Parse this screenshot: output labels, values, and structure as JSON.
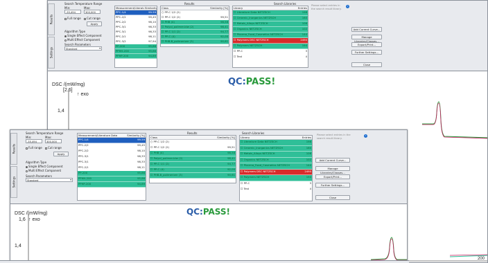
{
  "top_window": {
    "search_range_title": "Search Temperature Range",
    "min_label": "Min:",
    "max_label": "Max:",
    "min_value": "-35,494",
    "max_value": "300,000",
    "full_range": "Full range",
    "cut_range": "Cut range",
    "apply": "Apply",
    "algorithm_type": "Algorithm Type",
    "single_effect": "Single Effect Component",
    "multi_effect": "Multi Effect Component",
    "search_parameters": "Search Parameters",
    "standard": "Standard",
    "measurements_header": [
      "Measurement/Literature Data",
      "Similarity [%]"
    ],
    "measurements": [
      [
        "PPC-1/4",
        "99.59",
        "sel"
      ],
      [
        "PPC-2/2",
        "99,45",
        ""
      ],
      [
        "PPC-2/2",
        "98,10",
        ""
      ],
      [
        "PPC-3/1",
        "98,33",
        ""
      ],
      [
        "PPC-3/1",
        "98,33",
        ""
      ],
      [
        "PPC-2/1",
        "98,11",
        ""
      ],
      [
        "PPC-3/2",
        "97,94",
        ""
      ],
      [
        "PP-200",
        "95,86",
        "hit"
      ],
      [
        "PPHH-200",
        "95,86",
        "hit"
      ],
      [
        "PPHP-200",
        "94,89",
        "hit"
      ]
    ],
    "results_title": "Results",
    "results_header": [
      "Class",
      "Similarity [%]"
    ],
    "results_query": "PP-C 1/2 (2)",
    "results": [
      [
        "PP-C 1/2 (2)",
        "99,51",
        ""
      ],
      [
        "PHB (4)",
        "98,58",
        "hit"
      ],
      [
        "Polyol_polimer-blw (2)",
        "98,41",
        "hit"
      ],
      [
        "PP-C 1/1 (2)",
        "94,77",
        "hit"
      ],
      [
        "PP-C (4)",
        "92,00",
        "hit"
      ],
      [
        "PHB-B_polimerizer (3)",
        "90,61",
        "hit"
      ]
    ],
    "libraries_title": "Search Libraries",
    "libraries_header": [
      "Library",
      "Entries"
    ],
    "libraries": [
      [
        "Literature Data NETZSCH",
        "198",
        "hit"
      ],
      [
        "Ceramic_Inorganics NETZSCH",
        "160",
        "hit"
      ],
      [
        "Metals_Alloys NETZSCH",
        "106",
        "hit"
      ],
      [
        "Organics NETZSCH",
        "102",
        "hit"
      ],
      [
        "Pharma_Food_Cosmetics NETZSCH",
        "144",
        "hit"
      ],
      [
        "Polymers DSC NETZSCH",
        "2490",
        "red"
      ],
      [
        "Polymers NETZSCH",
        "194",
        "hit"
      ],
      [
        "PP-C",
        "3",
        ""
      ],
      [
        "Test",
        "4",
        ""
      ]
    ],
    "hint_text": "Please select entries in the search result library.",
    "add_current_curve": "Add Current Curve...",
    "manage_libraries": "Manage Libraries/Classes...",
    "export_print": "Export/Print...",
    "further_settings": "Further Settings...",
    "close": "Close",
    "tab_results": "Results",
    "tab_settings": "Settings",
    "qc_label": "QC:",
    "qc_status": "PASS!",
    "y_axis_label": "DSC /(mW/mg)",
    "exo_label": "↑ exo",
    "tick_a": "[2.6]",
    "tick_b": "1,4",
    "x_tick_end": "200"
  },
  "front_window": {
    "search_range_title": "Search Temperature Range",
    "min_label": "Min:",
    "max_label": "Max:",
    "min_value": "-35,494",
    "max_value": "300,000",
    "full_range": "Full range",
    "cut_range": "Cut range",
    "apply": "Apply",
    "algorithm_type": "Algorithm Type",
    "single_effect": "Single Effect Component",
    "multi_effect": "Multi Effect Component",
    "search_parameters": "Search Parameters",
    "standard": "Standard",
    "measurements_header": [
      "Measurement/Literature Data",
      "Similarity [%]"
    ],
    "measurements": [
      [
        "PPC-1/4",
        "99.59",
        "sel"
      ],
      [
        "PPC-2/2",
        "99,45",
        ""
      ],
      [
        "PPC-2/2",
        "98,10",
        ""
      ],
      [
        "PPC-3/1",
        "98,33",
        ""
      ],
      [
        "PPC-3/1",
        "98,33",
        ""
      ],
      [
        "PPC-2/1",
        "98,11",
        ""
      ],
      [
        "PP-200",
        "95,86",
        "hit"
      ],
      [
        "PPHH-200",
        "95,86",
        "hit"
      ],
      [
        "PPHP-200",
        "94,89",
        "hit"
      ]
    ],
    "results_title": "Results",
    "results_header": [
      "Class",
      "Similarity [%]"
    ],
    "results_query": "PP-C 1/2 (2)",
    "results": [
      [
        "PP-C 1/2 (2)",
        "99,51",
        ""
      ],
      [
        "PHB (4)",
        "98,58",
        "hit"
      ],
      [
        "Polyol_polimer-blw (2)",
        "98,41",
        "hit"
      ],
      [
        "PP-C 1/1 (2)",
        "94,77",
        "hit"
      ],
      [
        "PP-C (4)",
        "92,00",
        "hit"
      ],
      [
        "PHB-B_polimerizer (3)",
        "90,61",
        "hit"
      ]
    ],
    "libraries_title": "Search Libraries",
    "libraries_header": [
      "Library",
      "Entries"
    ],
    "libraries": [
      [
        "Literature Data NETZSCH",
        "198",
        "hit"
      ],
      [
        "Ceramic_Inorganics NETZSCH",
        "160",
        "hit"
      ],
      [
        "Metals_Alloys NETZSCH",
        "106",
        "hit"
      ],
      [
        "Organics NETZSCH",
        "102",
        "hit"
      ],
      [
        "Pharma_Food_Cosmetics NETZSCH",
        "144",
        "hit"
      ],
      [
        "Polymers DSC NETZSCH",
        "2490",
        "red"
      ],
      [
        "Polymers NETZSCH",
        "194",
        "hit"
      ],
      [
        "PP-C",
        "3",
        ""
      ],
      [
        "Test",
        "4",
        ""
      ]
    ],
    "hint_text": "Please select entries in the search result library.",
    "add_current_curve": "Add Current Curve...",
    "manage_libraries": "Manage Libraries/Classes...",
    "export_print": "Export/Print...",
    "further_settings": "Further Settings...",
    "close": "Close",
    "tab_results": "Results",
    "tab_settings": "Settings",
    "qc_label": "QC:",
    "qc_status": "PASS!",
    "y_axis_label": "DSC /(mW/mg)",
    "exo_label": "↑ exo",
    "tick_a": "1,6",
    "tick_b": "1,4"
  },
  "colors": {
    "accent_teal": "#2fbf98",
    "selection_blue": "#1f5fbf",
    "alert_red": "#d82b2b",
    "pass_green": "#2a9a3c",
    "qc_blue": "#2b5da8"
  }
}
